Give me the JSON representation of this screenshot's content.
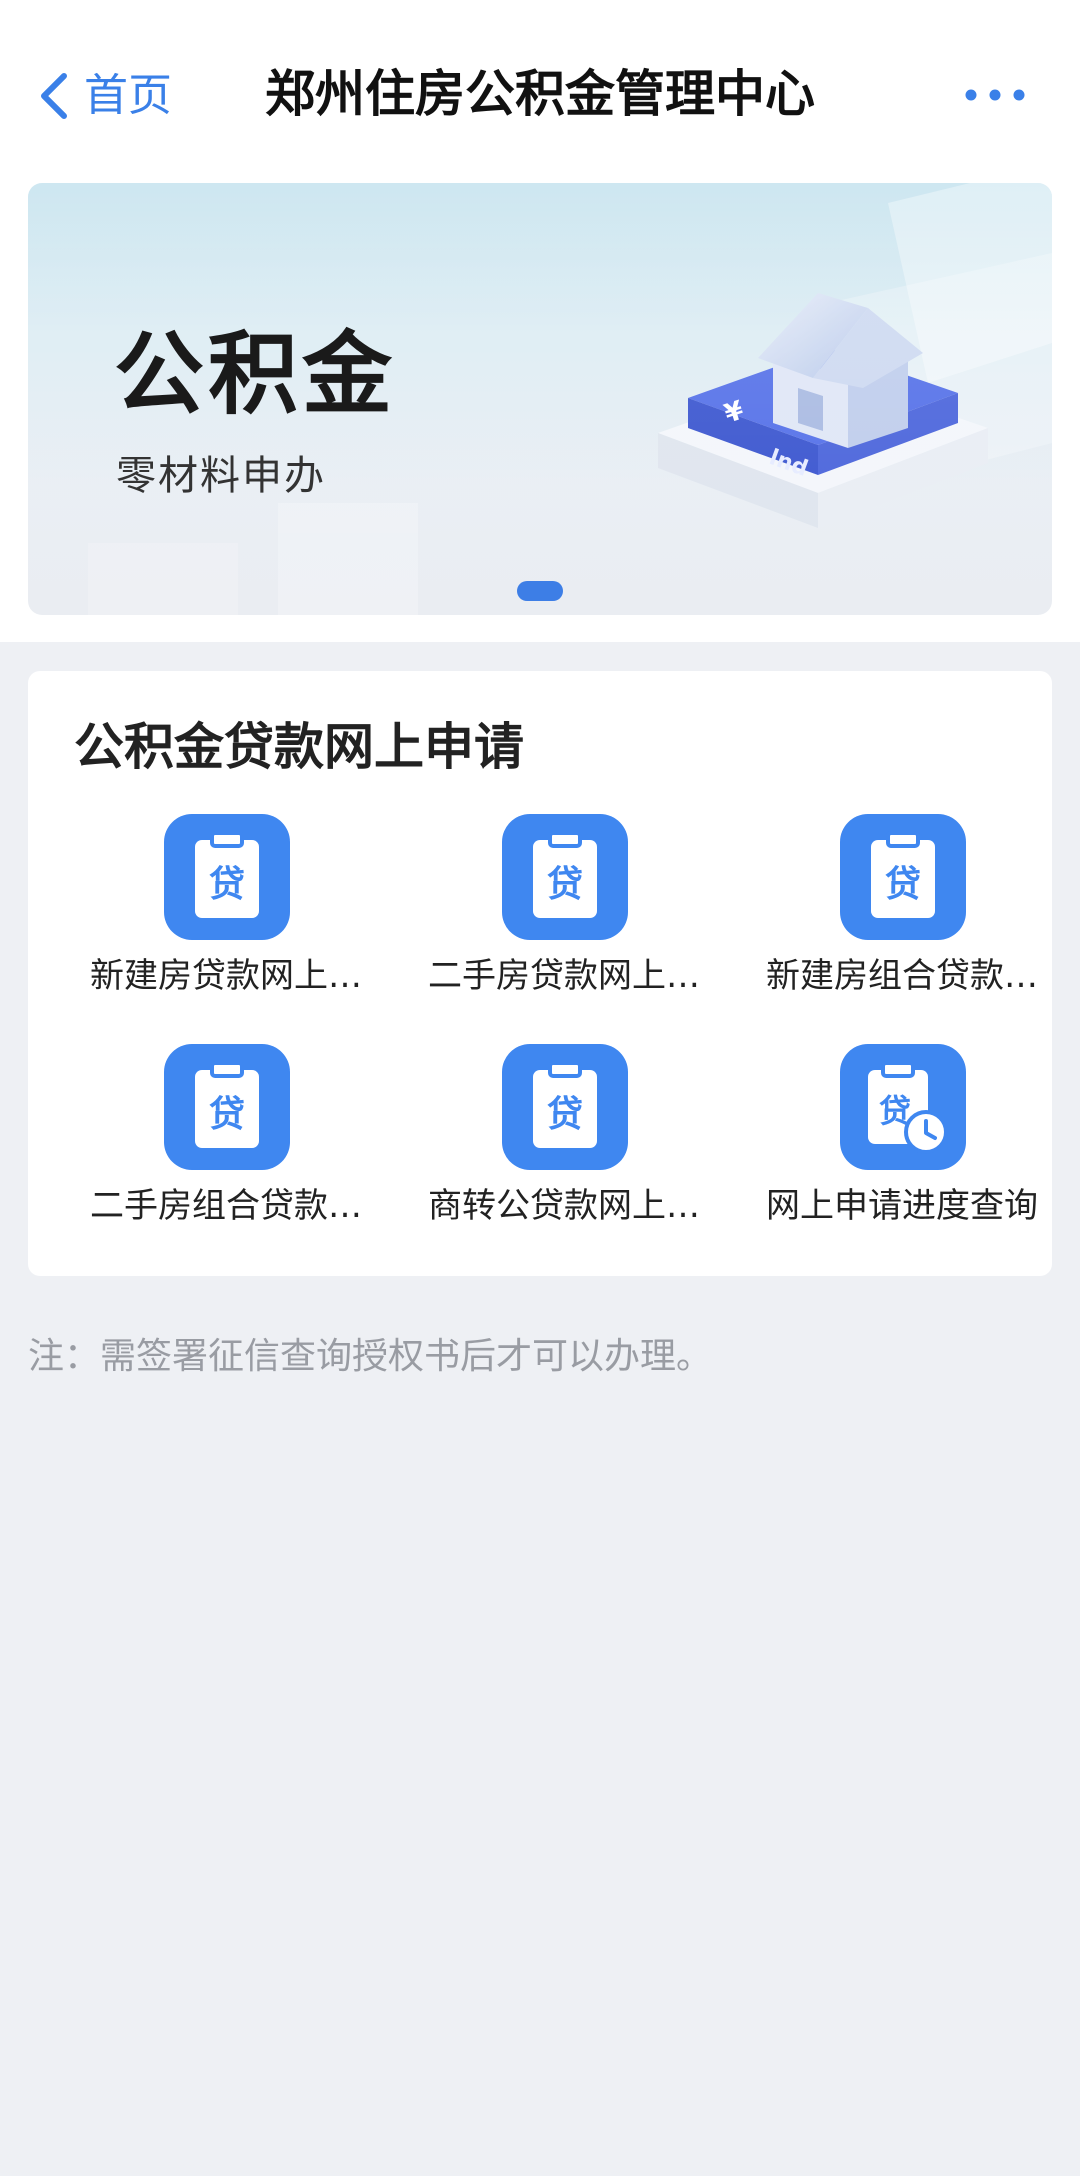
{
  "nav": {
    "back_label": "首页",
    "title": "郑州住房公积金管理中心",
    "more_icon": "more-dots-icon",
    "accent_color": "#3a80e8"
  },
  "banner": {
    "title": "公积金",
    "subtitle": "零材料申办",
    "illustration_icon": "house-on-platform-icon"
  },
  "section": {
    "title": "公积金贷款网上申请",
    "items": [
      {
        "label": "新建房贷款网上…",
        "icon": "loan-clipboard-icon"
      },
      {
        "label": "二手房贷款网上…",
        "icon": "loan-clipboard-icon"
      },
      {
        "label": "新建房组合贷款…",
        "icon": "loan-clipboard-icon"
      },
      {
        "label": "二手房组合贷款…",
        "icon": "loan-clipboard-icon"
      },
      {
        "label": "商转公贷款网上…",
        "icon": "loan-clipboard-icon"
      },
      {
        "label": "网上申请进度查询",
        "icon": "loan-progress-clock-icon"
      }
    ],
    "icon_glyph": "贷",
    "icon_color": "#3f87f0"
  },
  "note": "注：需签署征信查询授权书后才可以办理。"
}
